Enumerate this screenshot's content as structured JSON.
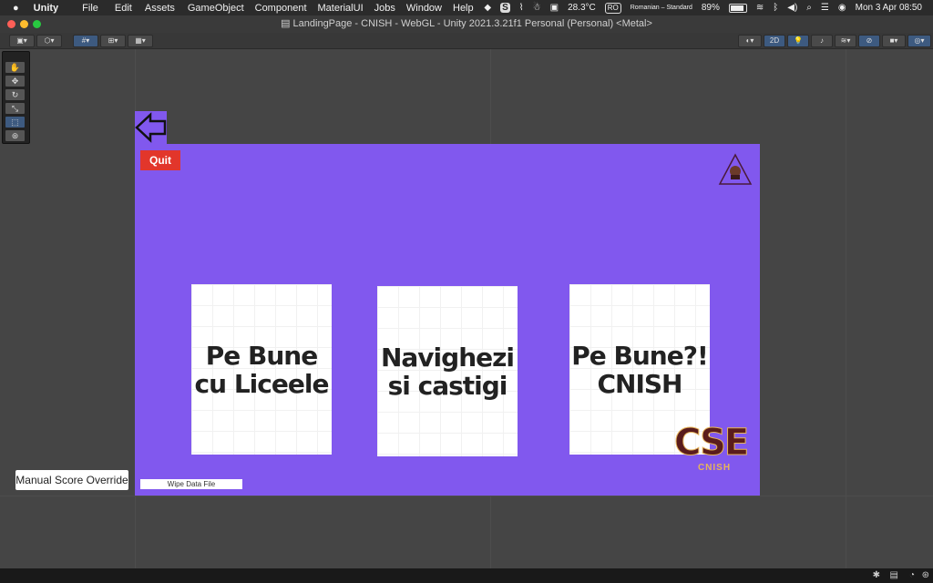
{
  "menubar": {
    "apple_icon": "apple-icon",
    "app_name": "Unity",
    "items": [
      "File",
      "Edit",
      "Assets",
      "GameObject",
      "Component",
      "MaterialUI",
      "Jobs",
      "Window",
      "Help"
    ],
    "temperature": "28.3°C",
    "input_code": "RO",
    "input_name": "Romanian – Standard",
    "battery": "89%",
    "battery_level": 0.89,
    "clock": "Mon 3 Apr  08:50"
  },
  "window": {
    "title": "LandingPage - CNISH - WebGL - Unity 2021.3.21f1 Personal (Personal) <Metal>"
  },
  "toolbar": {
    "mode_2d_label": "2D"
  },
  "game": {
    "quit_label": "Quit",
    "cards": [
      {
        "label": "Pe Bune\ncu Liceele"
      },
      {
        "label": "Navighezi\nsi castigi"
      },
      {
        "label": "Pe Bune?!\nCNISH"
      }
    ],
    "wipe_label": "Wipe Data File",
    "logo_text": "CSE",
    "logo_sub": "CNISH"
  },
  "manual_override_label": "Manual Score Override",
  "colors": {
    "canvas": "#8158ee",
    "quit": "#e2362b",
    "selection": "#3d5a80"
  }
}
